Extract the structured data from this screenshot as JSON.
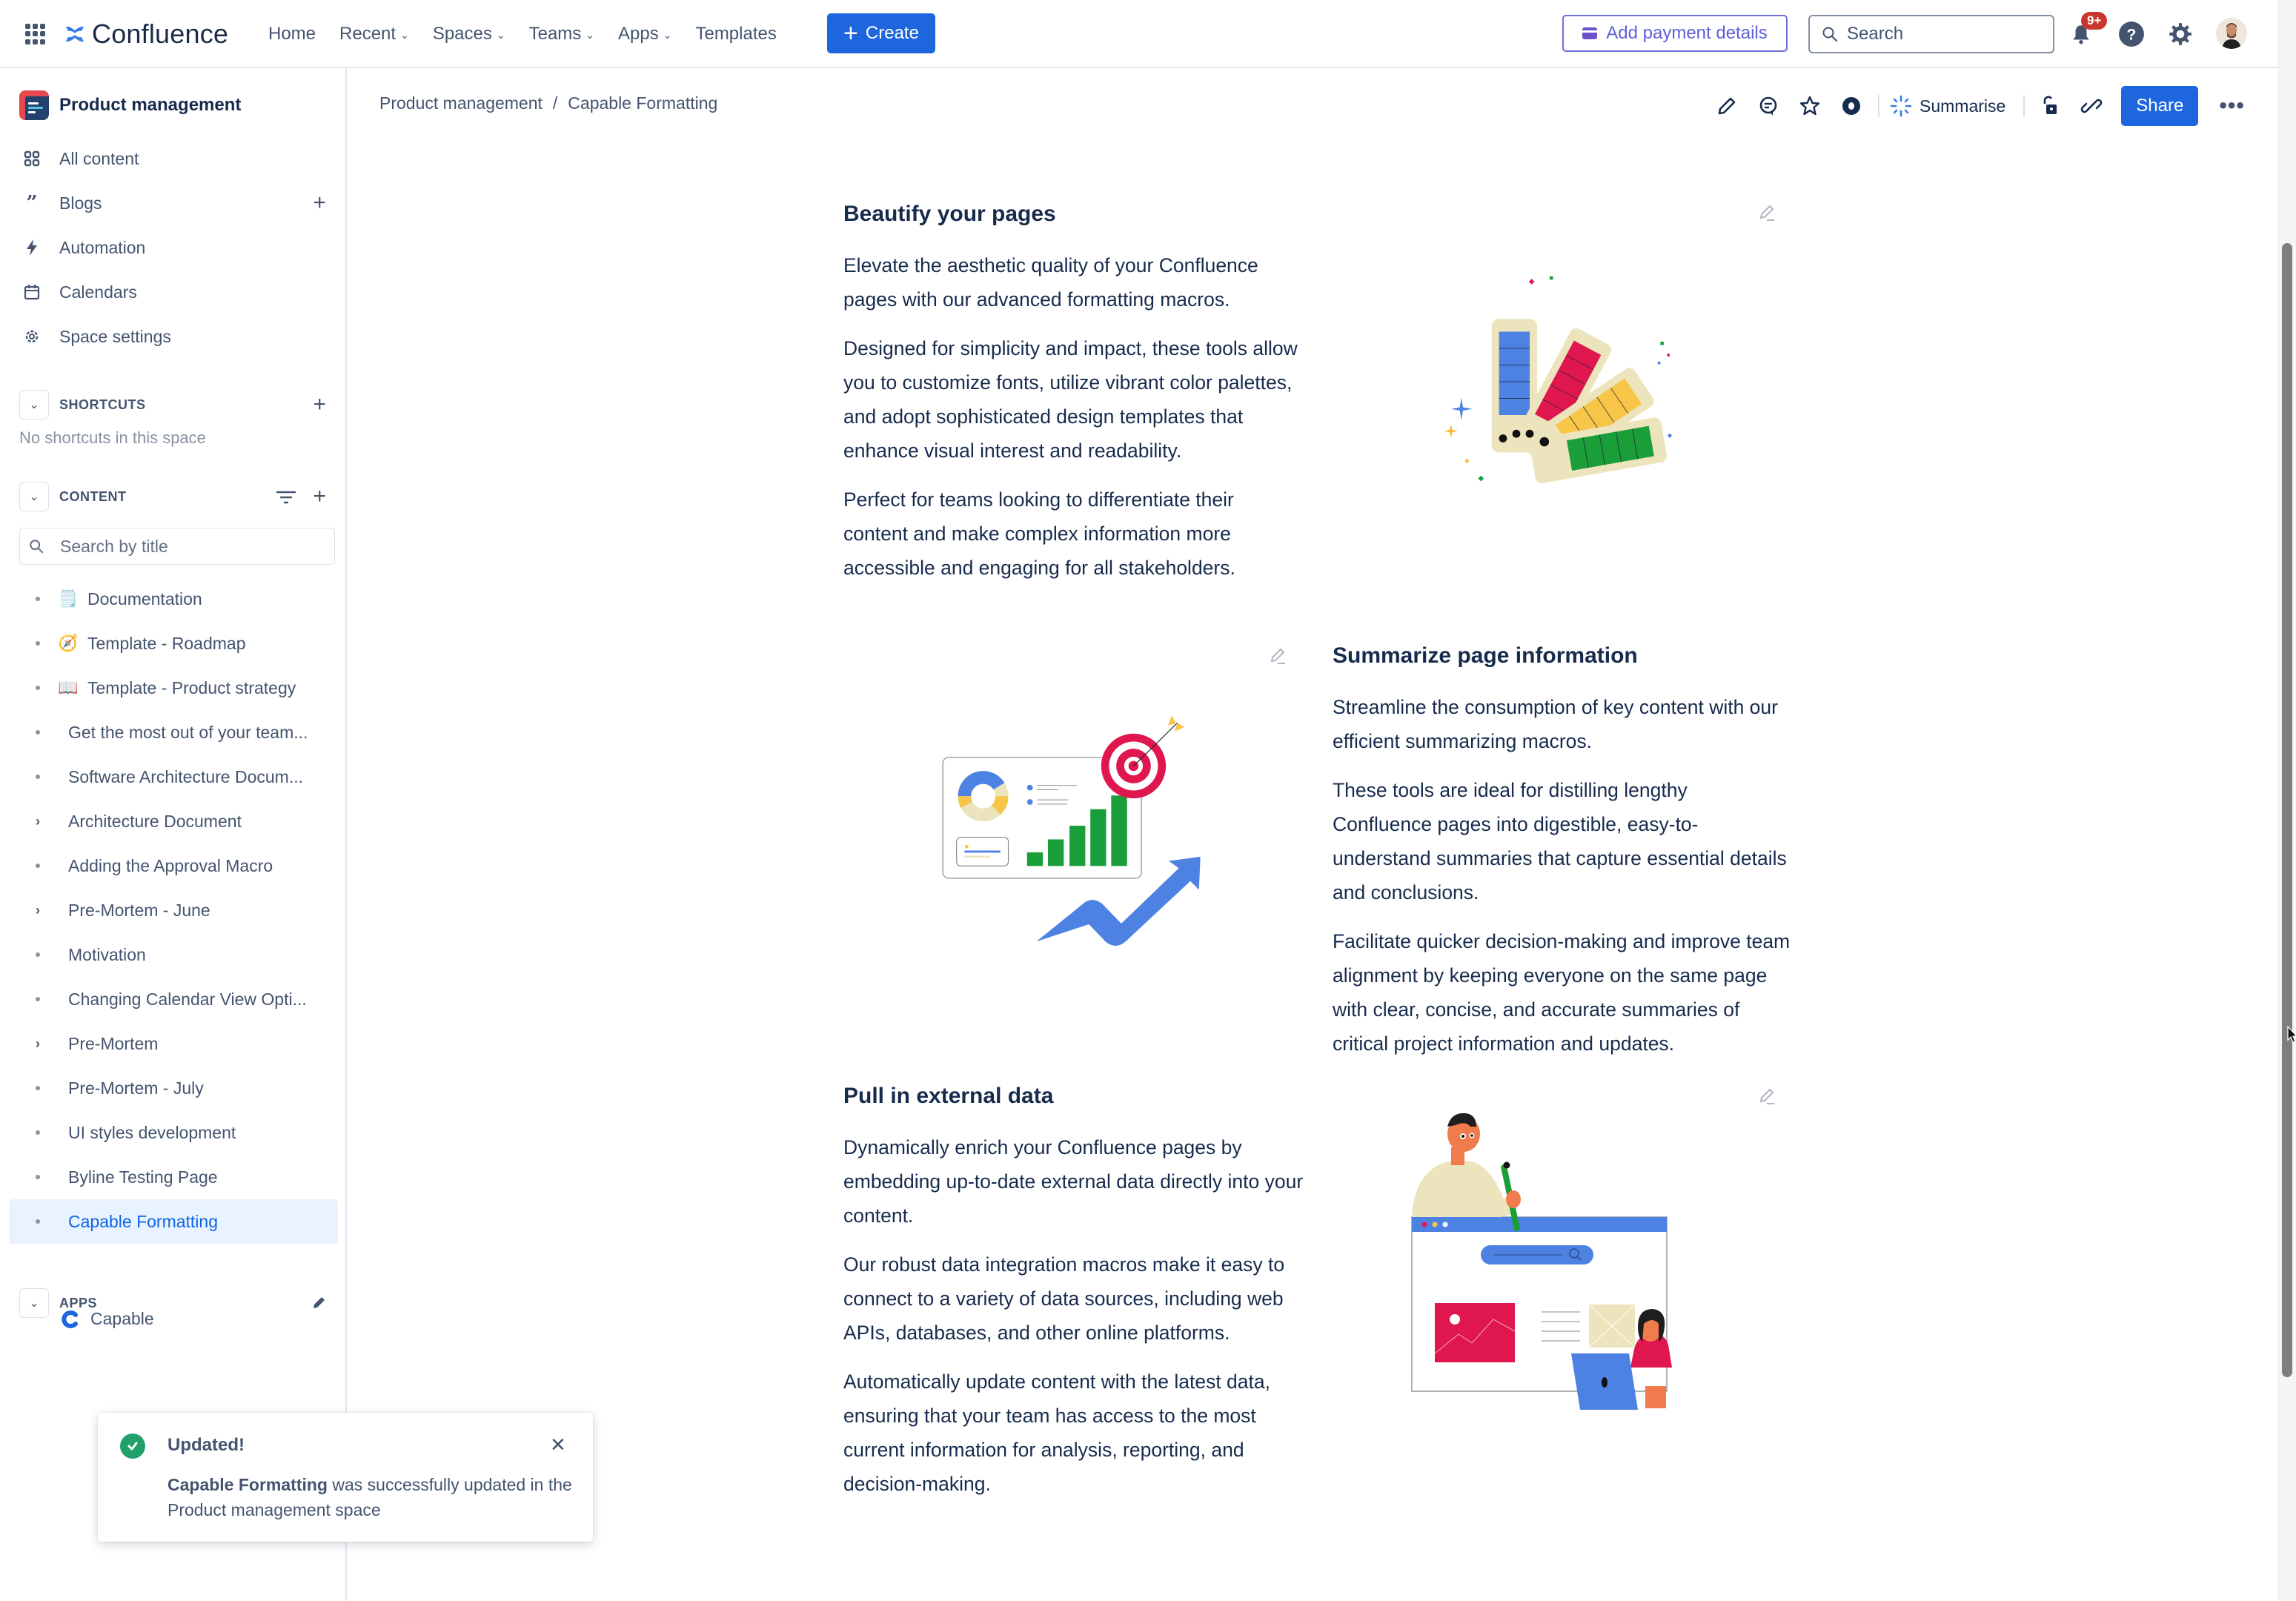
{
  "header": {
    "app_name": "Confluence",
    "nav": [
      {
        "label": "Home",
        "dropdown": false
      },
      {
        "label": "Recent",
        "dropdown": true
      },
      {
        "label": "Spaces",
        "dropdown": true
      },
      {
        "label": "Teams",
        "dropdown": true
      },
      {
        "label": "Apps",
        "dropdown": true
      },
      {
        "label": "Templates",
        "dropdown": false
      }
    ],
    "create_label": "Create",
    "payment_label": "Add payment details",
    "search_placeholder": "Search",
    "notifications_badge": "9+",
    "icons": [
      "app-switcher-icon",
      "notification-bell-icon",
      "help-icon",
      "settings-icon",
      "avatar"
    ]
  },
  "sidebar": {
    "space_name": "Product management",
    "links": [
      {
        "label": "All content",
        "icon": "grid-icon",
        "has_add": false
      },
      {
        "label": "Blogs",
        "icon": "quote-icon",
        "has_add": true
      },
      {
        "label": "Automation",
        "icon": "lightning-icon",
        "has_add": false
      },
      {
        "label": "Calendars",
        "icon": "calendar-icon",
        "has_add": false
      },
      {
        "label": "Space settings",
        "icon": "gear-icon",
        "has_add": false
      }
    ],
    "shortcuts": {
      "label": "SHORTCUTS",
      "empty_text": "No shortcuts in this space"
    },
    "content": {
      "label": "CONTENT",
      "search_placeholder": "Search by title",
      "tree": [
        {
          "label": "Documentation",
          "emoji": "🗒️",
          "expandable": false,
          "active": false
        },
        {
          "label": "Template - Roadmap",
          "emoji": "🧭",
          "expandable": false,
          "active": false
        },
        {
          "label": "Template - Product strategy",
          "emoji": "📖",
          "expandable": false,
          "active": false
        },
        {
          "label": "Get the most out of your team...",
          "emoji": "",
          "expandable": false,
          "active": false
        },
        {
          "label": "Software Architecture Docum...",
          "emoji": "",
          "expandable": false,
          "active": false
        },
        {
          "label": "Architecture Document",
          "emoji": "",
          "expandable": true,
          "active": false
        },
        {
          "label": "Adding the Approval Macro",
          "emoji": "",
          "expandable": false,
          "active": false
        },
        {
          "label": "Pre-Mortem - June",
          "emoji": "",
          "expandable": true,
          "active": false
        },
        {
          "label": "Motivation",
          "emoji": "",
          "expandable": false,
          "active": false
        },
        {
          "label": "Changing Calendar View Opti...",
          "emoji": "",
          "expandable": false,
          "active": false
        },
        {
          "label": "Pre-Mortem",
          "emoji": "",
          "expandable": true,
          "active": false
        },
        {
          "label": "Pre-Mortem - July",
          "emoji": "",
          "expandable": false,
          "active": false
        },
        {
          "label": "UI styles development",
          "emoji": "",
          "expandable": false,
          "active": false
        },
        {
          "label": "Byline Testing Page",
          "emoji": "",
          "expandable": false,
          "active": false
        },
        {
          "label": "Capable Formatting",
          "emoji": "",
          "expandable": false,
          "active": true
        }
      ]
    },
    "apps": {
      "label": "APPS",
      "items": [
        {
          "label": "Capable"
        }
      ]
    }
  },
  "toast": {
    "title": "Updated!",
    "page_name": "Capable Formatting",
    "message": " was successfully updated in the Product management space"
  },
  "page": {
    "breadcrumb": [
      "Product management",
      "Capable Formatting"
    ],
    "actions": {
      "summarise_label": "Summarise",
      "share_label": "Share",
      "icons": [
        "edit-icon",
        "comment-icon",
        "star-icon",
        "watch-icon",
        "restrictions-icon",
        "link-icon",
        "more-icon"
      ]
    },
    "sections": [
      {
        "title": "Beautify your pages",
        "paragraphs": [
          "Elevate the aesthetic quality of your Confluence pages with our advanced formatting macros.",
          "Designed for simplicity and impact, these tools allow you to customize fonts, utilize vibrant color palettes, and adopt sophisticated design templates that enhance visual interest and readability.",
          "Perfect for teams looking to differentiate their content and make complex information more accessible and engaging for all stakeholders."
        ],
        "illustration": "color-swatches-illustration"
      },
      {
        "title": "Summarize page information",
        "paragraphs": [
          "Streamline the consumption of key content with our efficient summarizing macros.",
          "These tools are ideal for distilling lengthy Confluence pages into digestible, easy-to-understand summaries that capture essential details and conclusions.",
          "Facilitate quicker decision-making and improve team alignment by keeping everyone on the same page with clear, concise, and accurate summaries of critical project information and updates."
        ],
        "illustration": "dashboard-target-illustration"
      },
      {
        "title": "Pull in external data",
        "paragraphs": [
          "Dynamically enrich your Confluence pages by embedding up-to-date external data directly into your content.",
          "Our robust data integration macros make it easy to connect to a variety of data sources, including web APIs, databases, and other online platforms.",
          "Automatically update content with the latest data, ensuring that your team has access to the most current information for analysis, reporting, and decision-making."
        ],
        "illustration": "people-browser-illustration"
      }
    ]
  },
  "colors": {
    "brand_blue": "#1d66dd",
    "text_primary": "#172b4d",
    "text_secondary": "#44546f",
    "active_bg": "#e9f2ff",
    "active_text": "#0c66e4",
    "success": "#22a06b",
    "badge_red": "#c9372c",
    "payment_purple": "#5e5fd8"
  }
}
